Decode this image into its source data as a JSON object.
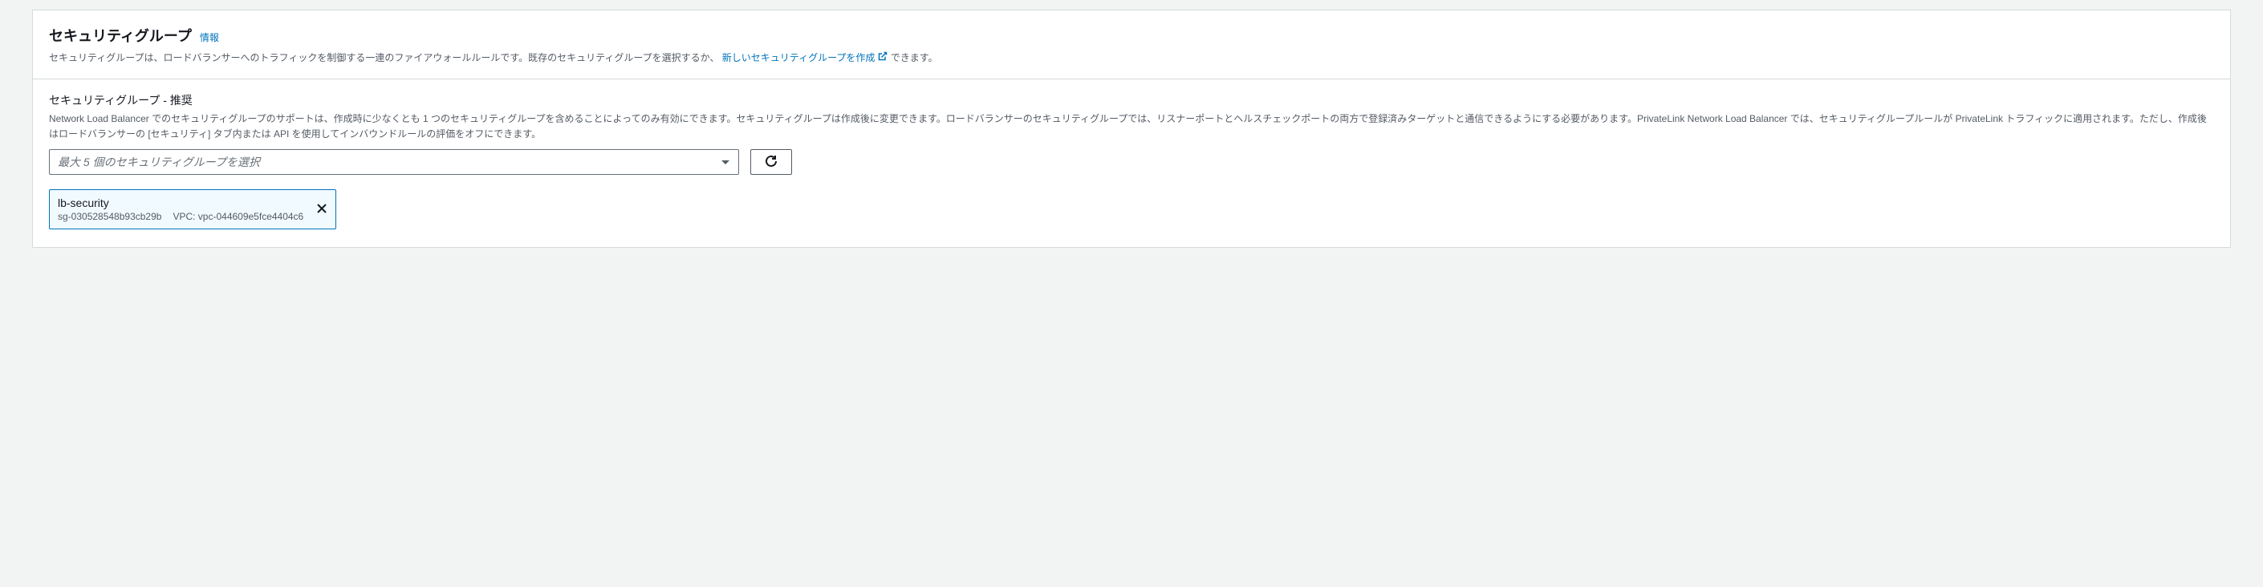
{
  "header": {
    "title": "セキュリティグループ",
    "info_label": "情報",
    "desc_before": "セキュリティグループは、ロードバランサーへのトラフィックを制御する一連のファイアウォールルールです。既存のセキュリティグループを選択するか、",
    "create_link": "新しいセキュリティグループを作成",
    "desc_after": " できます。"
  },
  "field": {
    "label": "セキュリティグループ - 推奨",
    "hint": "Network Load Balancer でのセキュリティグループのサポートは、作成時に少なくとも 1 つのセキュリティグループを含めることによってのみ有効にできます。セキュリティグループは作成後に変更できます。ロードバランサーのセキュリティグループでは、リスナーポートとヘルスチェックポートの両方で登録済みターゲットと通信できるようにする必要があります。PrivateLink Network Load Balancer では、セキュリティグループルールが PrivateLink トラフィックに適用されます。ただし、作成後はロードバランサーの [セキュリティ] タブ内または API を使用してインバウンドルールの評価をオフにできます。",
    "placeholder": "最大 5 個のセキュリティグループを選択"
  },
  "selected": [
    {
      "name": "lb-security",
      "sg_id": "sg-030528548b93cb29b",
      "vpc_label": "VPC: vpc-044609e5fce4404c6"
    }
  ]
}
